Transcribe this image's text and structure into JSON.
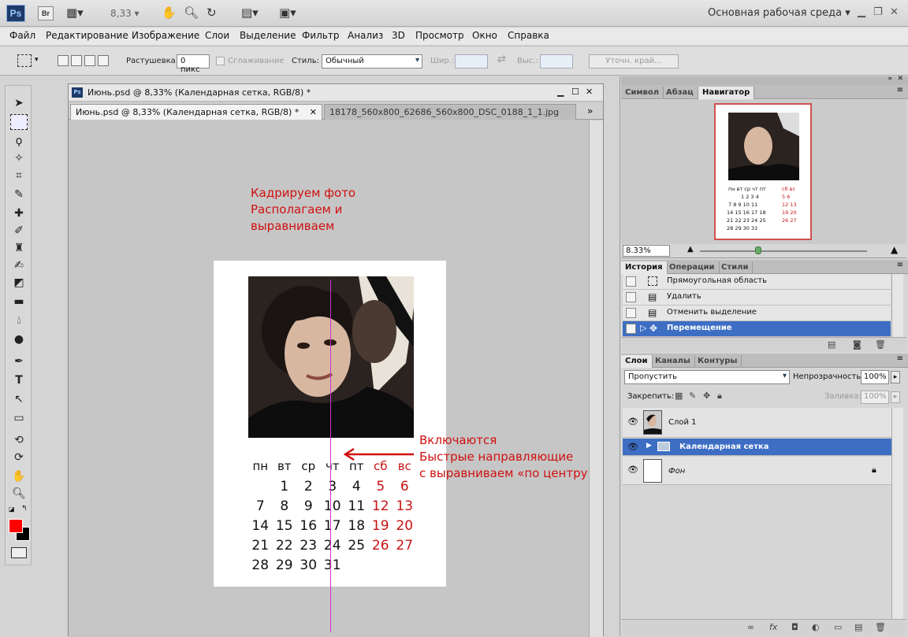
{
  "app": {
    "logo": "Ps",
    "bridge": "Br",
    "zoom": "8,33",
    "workspace": "Основная рабочая среда"
  },
  "menu": [
    "Файл",
    "Редактирование",
    "Изображение",
    "Слои",
    "Выделение",
    "Фильтр",
    "Анализ",
    "3D",
    "Просмотр",
    "Окно",
    "Справка"
  ],
  "options": {
    "feather_label": "Растушевка:",
    "feather_value": "0 пикс",
    "antialias_label": "Сглаживание",
    "style_label": "Стиль:",
    "style_value": "Обычный",
    "width_label": "Шир.:",
    "height_label": "Выс.:",
    "refine_button": "Уточн. край..."
  },
  "document": {
    "title": "Июнь.psd @ 8,33% (Календарная сетка, RGB/8) *",
    "tabs": [
      {
        "label": "Июнь.psd @ 8,33% (Календарная сетка, RGB/8) *",
        "active": true
      },
      {
        "label": "18178_560x800_62686_560x800_DSC_0188_1_1.jpg",
        "active": false
      }
    ]
  },
  "annotations": {
    "top_lines": [
      "Кадрируем фото",
      "Располагаем и",
      "выравниваем"
    ],
    "bottom_lines": [
      "Включаются",
      "Быстрые направляющие",
      "с выравниваем «по центру»"
    ]
  },
  "calendar": {
    "weekdays": [
      "пн",
      "вт",
      "ср",
      "чт",
      "пт",
      "сб",
      "вс"
    ],
    "weeks": [
      [
        "",
        "1",
        "2",
        "3",
        "4",
        "5",
        "6"
      ],
      [
        "7",
        "8",
        "9",
        "10",
        "11",
        "12",
        "13"
      ],
      [
        "14",
        "15",
        "16",
        "17",
        "18",
        "19",
        "20"
      ],
      [
        "21",
        "22",
        "23",
        "24",
        "25",
        "26",
        "27"
      ],
      [
        "28",
        "29",
        "30",
        "31",
        "",
        "",
        ""
      ]
    ],
    "weekend_color": "#c81414"
  },
  "panels": {
    "top_tabs": [
      "Символ",
      "Абзац",
      "Навигатор"
    ],
    "navigator_zoom": "8.33%",
    "history_tabs": [
      "История",
      "Операции",
      "Стили"
    ],
    "history_items": [
      "Прямоугольная область",
      "Удалить",
      "Отменить выделение",
      "Перемещение"
    ],
    "layers_tabs": [
      "Слои",
      "Каналы",
      "Контуры"
    ],
    "blend_mode": "Пропустить",
    "opacity_label": "Непрозрачность:",
    "opacity_value": "100%",
    "lock_label": "Закрепить:",
    "fill_label": "Заливка:",
    "fill_value": "100%",
    "layers": [
      "Слой 1",
      "Календарная сетка",
      "Фон"
    ]
  },
  "colors": {
    "accent": "#3d6ec4",
    "foreground": "#ff0000",
    "background": "#000000",
    "annotation": "#d01010"
  }
}
